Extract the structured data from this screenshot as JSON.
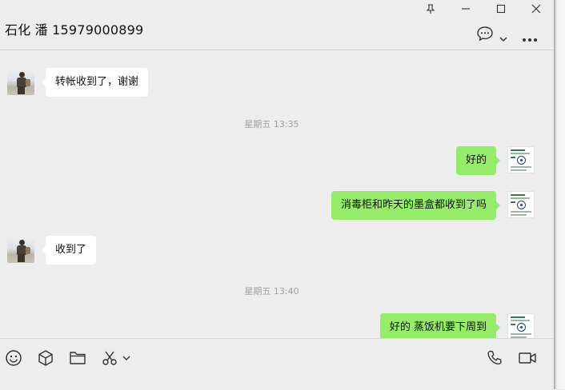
{
  "window": {
    "controls": [
      "pin-icon",
      "minimize-icon",
      "maximize-icon",
      "close-icon"
    ]
  },
  "header": {
    "title": "石化 潘 15979000899",
    "icons": [
      "chat-bubble-icon",
      "chevron-down-icon",
      "more-icon"
    ]
  },
  "messages": [
    {
      "type": "incoming",
      "text": "转帐收到了，谢谢"
    },
    {
      "type": "time",
      "text": "星期五 13:35"
    },
    {
      "type": "outgoing",
      "text": "好的"
    },
    {
      "type": "outgoing",
      "text": "消毒柜和昨天的墨盒都收到了吗"
    },
    {
      "type": "incoming",
      "text": "收到了"
    },
    {
      "type": "time",
      "text": "星期五 13:40"
    },
    {
      "type": "outgoing",
      "text": "好的 蒸饭机要下周到"
    }
  ],
  "toolbar": {
    "icons": [
      "emoji-icon",
      "cube-icon",
      "folder-icon",
      "scissors-icon",
      "chevron-down-icon",
      "phone-icon",
      "video-icon"
    ]
  },
  "colors": {
    "background": "#ededed",
    "outgoing_bubble": "#95ec69",
    "incoming_bubble": "#ffffff",
    "timestamp": "#a0a0a0"
  }
}
